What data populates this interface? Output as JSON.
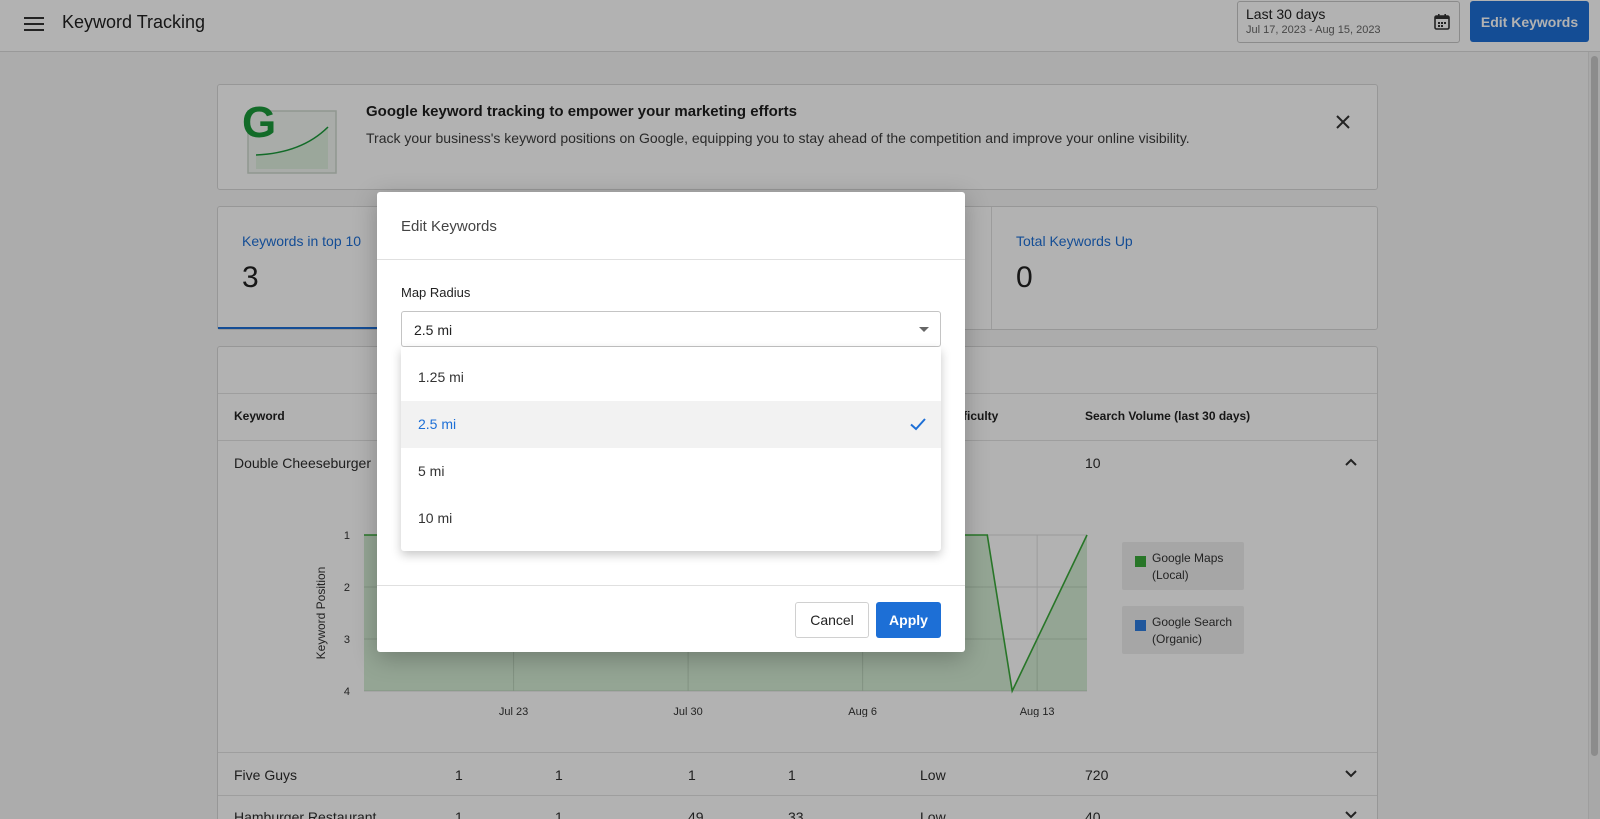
{
  "header": {
    "title": "Keyword Tracking",
    "date_label": "Last 30 days",
    "date_range": "Jul 17, 2023 - Aug 15, 2023",
    "edit_button": "Edit Keywords"
  },
  "banner": {
    "title": "Google keyword tracking to empower your marketing efforts",
    "text": "Track your business's keyword positions on Google, equipping you to stay ahead of the competition and improve your online visibility.",
    "logo_letter": "G"
  },
  "stats": [
    {
      "label": "Keywords in top 10",
      "value": "3"
    },
    {
      "label": "Total Keywords Up",
      "value": "0"
    }
  ],
  "table": {
    "headers": {
      "keyword": "Keyword",
      "difficulty": "ficulty",
      "volume": "Search Volume (last 30 days)"
    },
    "expanded_row": {
      "keyword": "Double Cheeseburger",
      "volume": "10"
    },
    "rows": [
      {
        "keyword": "Five Guys",
        "c1": "1",
        "c2": "1",
        "c3": "1",
        "c4": "1",
        "difficulty": "Low",
        "volume": "720"
      },
      {
        "keyword": "Hamburger Restaurant",
        "c1": "1",
        "c2": "1",
        "c3": "49",
        "c4": "33",
        "difficulty": "Low",
        "volume": "40"
      }
    ]
  },
  "chart_data": {
    "type": "line",
    "ylabel": "Keyword Position",
    "ylim": [
      4,
      1
    ],
    "y_ticks": [
      "1",
      "2",
      "3",
      "4"
    ],
    "x_ticks": [
      "Jul 23",
      "Jul 30",
      "Aug 6",
      "Aug 13"
    ],
    "x": [
      "2023-07-17",
      "2023-08-11",
      "2023-08-12",
      "2023-08-15"
    ],
    "series": [
      {
        "name": "Google Maps (Local)",
        "color": "#3aa93a",
        "values": [
          1,
          1,
          4,
          1
        ]
      }
    ],
    "legend": [
      {
        "label": "Google Maps\n(Local)",
        "color": "#3aa93a"
      },
      {
        "label": "Google Search\n(Organic)",
        "color": "#2e7de0"
      }
    ],
    "grid": true
  },
  "dialog": {
    "title": "Edit Keywords",
    "field_label": "Map Radius",
    "selected": "2.5 mi",
    "options": [
      "1.25 mi",
      "2.5 mi",
      "5 mi",
      "10 mi"
    ],
    "cancel": "Cancel",
    "apply": "Apply"
  },
  "colors": {
    "accent": "#1d6fd6",
    "google_green": "#1a9a3a"
  }
}
